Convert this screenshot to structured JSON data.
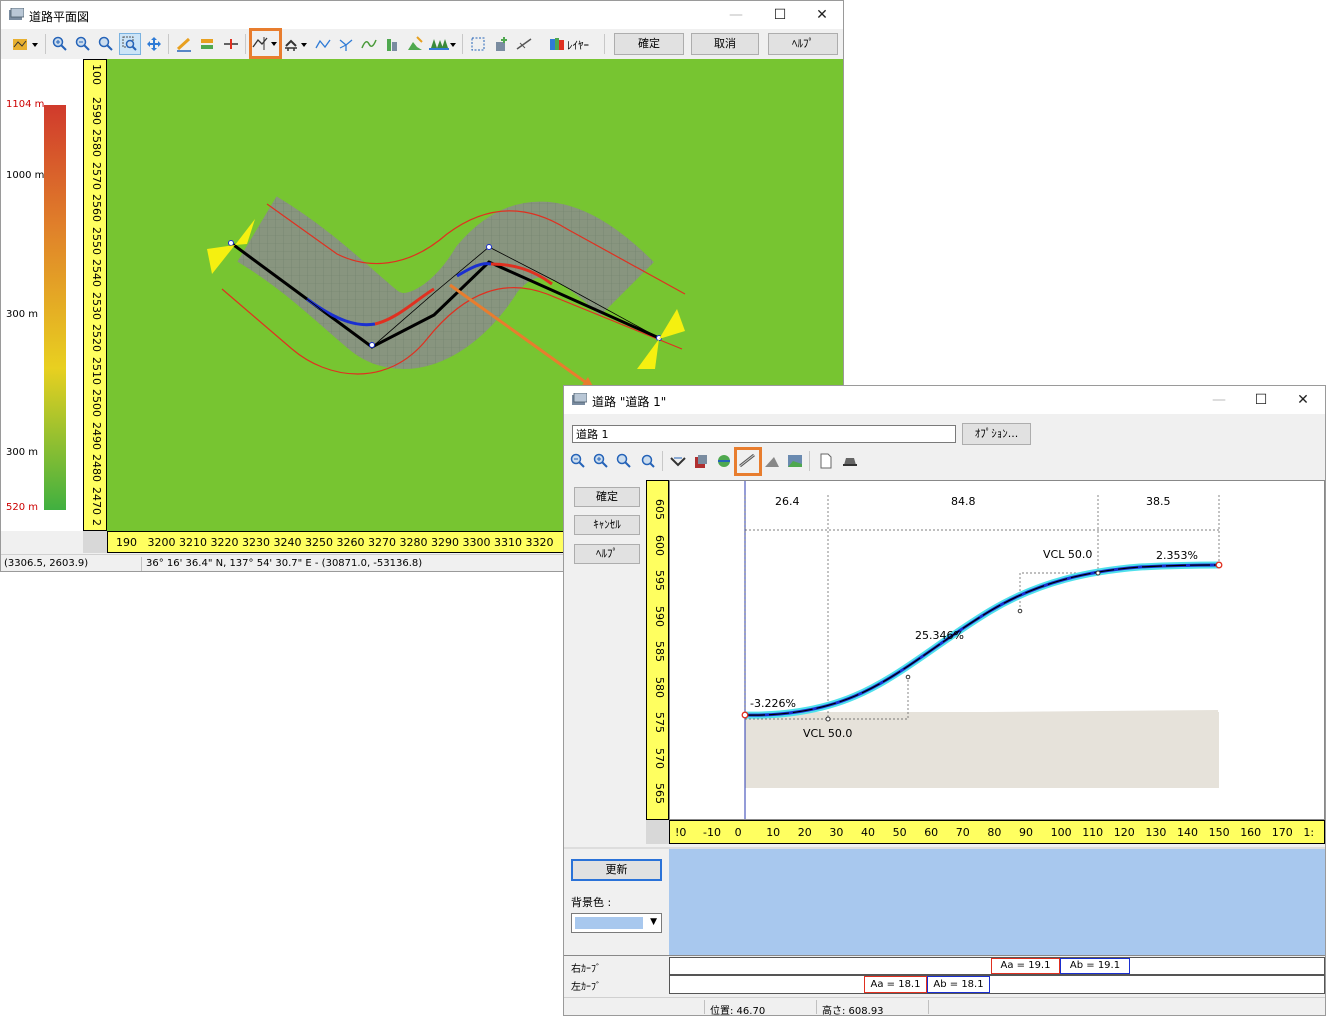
{
  "plan_window": {
    "title": "道路平面図",
    "toolbar": {
      "layer_label": "ﾚｲﾔｰ",
      "confirm_label": "確定",
      "cancel_label": "取消",
      "help_label": "ﾍﾙﾌﾟ"
    },
    "elevation_legend": {
      "labels": [
        "1104 m",
        "1000 m",
        "300 m",
        "300 m",
        "520 m"
      ],
      "label_colors": [
        "#cc0000",
        "#000000",
        "#000000",
        "#000000",
        "#cc0000"
      ],
      "gradient_colors": [
        "#d03a2c",
        "#e0802a",
        "#e8d020",
        "#40b040"
      ]
    },
    "y_ruler_ticks": [
      "100",
      "2590",
      "2580",
      "2570",
      "2560",
      "2550",
      "2540",
      "2530",
      "2520",
      "2510",
      "2500",
      "2490",
      "2480",
      "2470",
      "2"
    ],
    "x_ruler_ticks": [
      "190",
      "3200",
      "3210",
      "3220",
      "3230",
      "3240",
      "3250",
      "3260",
      "3270",
      "3280",
      "3290",
      "3300",
      "3310",
      "3320"
    ],
    "status": {
      "coords": "(3306.5, 2603.9)",
      "geo": "36° 16' 36.4\" N, 137° 54' 30.7\" E - (30871.0, -53136.8)"
    },
    "colors": {
      "map_bg": "#77c531",
      "highlight": "#e87d2e"
    }
  },
  "profile_window": {
    "title": "道路 \"道路 1\"",
    "road_name_value": "道路 1",
    "options_label": "ｵﾌﾟｼｮﾝ...",
    "side_buttons": {
      "confirm": "確定",
      "cancel": "ｷｬﾝｾﾙ",
      "help": "ﾍﾙﾌﾟ"
    },
    "y_ruler_ticks": [
      "605",
      "600",
      "595",
      "590",
      "585",
      "580",
      "575",
      "570",
      "565"
    ],
    "x_ruler_ticks": [
      "-10",
      "0",
      "10",
      "20",
      "30",
      "40",
      "50",
      "60",
      "70",
      "80",
      "90",
      "100",
      "110",
      "120",
      "130",
      "140",
      "150",
      "160",
      "170",
      "1:"
    ],
    "x_ruler_first": "!0",
    "profile": {
      "segment_lengths": [
        "26.4",
        "84.8",
        "38.5"
      ],
      "grades": [
        "-3.226%",
        "25.346%",
        "2.353%"
      ],
      "vcl_labels": [
        "VCL  50.0",
        "VCL  50.0"
      ]
    },
    "update_label": "更新",
    "bg_color_label": "背景色 :",
    "bg_color_value": "#a8c8ee",
    "curves": {
      "right_label": "右ｶｰﾌﾞ",
      "left_label": "左ｶｰﾌﾞ",
      "right_values": [
        "Aa = 19.1",
        "Ab = 19.1"
      ],
      "left_values": [
        "Aa = 18.1",
        "Ab = 18.1"
      ]
    },
    "status": {
      "position": "位置: 46.70",
      "height": "高さ: 608.93"
    }
  }
}
